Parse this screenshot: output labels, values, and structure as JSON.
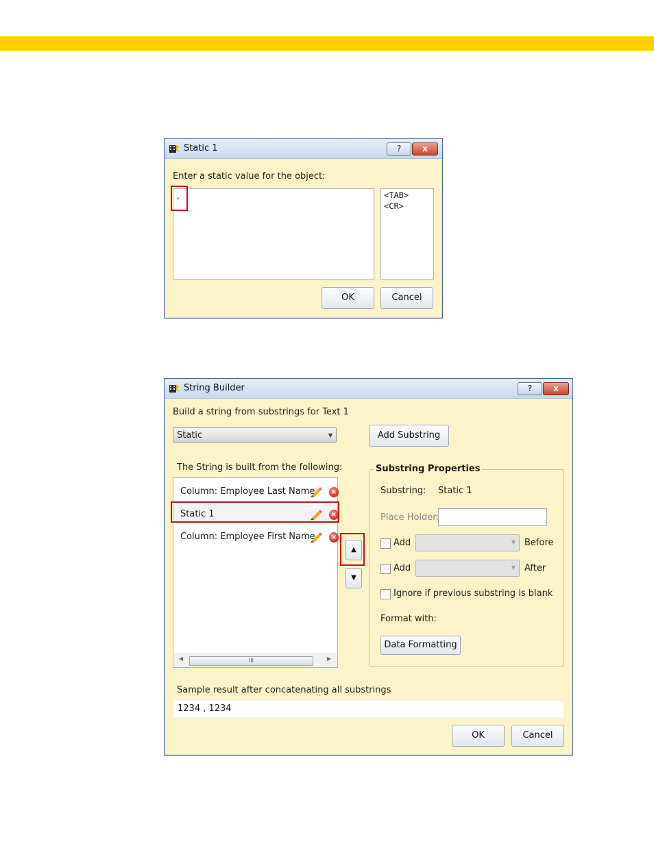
{
  "static_dialog": {
    "title": "Static 1",
    "prompt": "Enter a static value for the object:",
    "value": ",",
    "special_chars": [
      "<TAB>",
      "<CR>"
    ],
    "help_label": "?",
    "close_label": "x",
    "ok_label": "OK",
    "cancel_label": "Cancel"
  },
  "builder_dialog": {
    "title": "String Builder",
    "heading": "Build a string from substrings for Text 1",
    "type_select": "Static",
    "add_substring_label": "Add Substring",
    "list_heading": "The String is built from the following:",
    "items": [
      {
        "label": "Column: Employee Last Name"
      },
      {
        "label": "Static 1"
      },
      {
        "label": "Column: Employee First Name"
      }
    ],
    "props": {
      "title": "Substring Properties",
      "substring_label": "Substring:",
      "substring_value": "Static 1",
      "placeholder_label": "Place Holder:",
      "add_label": "Add",
      "before_label": "Before",
      "after_label": "After",
      "ignore_label": "Ignore if previous substring is blank",
      "format_label": "Format with:",
      "data_formatting_label": "Data Formatting"
    },
    "sample_label": "Sample result after concatenating all substrings",
    "sample_value": "1234 , 1234",
    "help_label": "?",
    "close_label": "x",
    "ok_label": "OK",
    "cancel_label": "Cancel"
  },
  "colors": {
    "banner": "#ffd000",
    "dialog_bg": "#fdf3c8",
    "highlight": "#c0141a"
  }
}
